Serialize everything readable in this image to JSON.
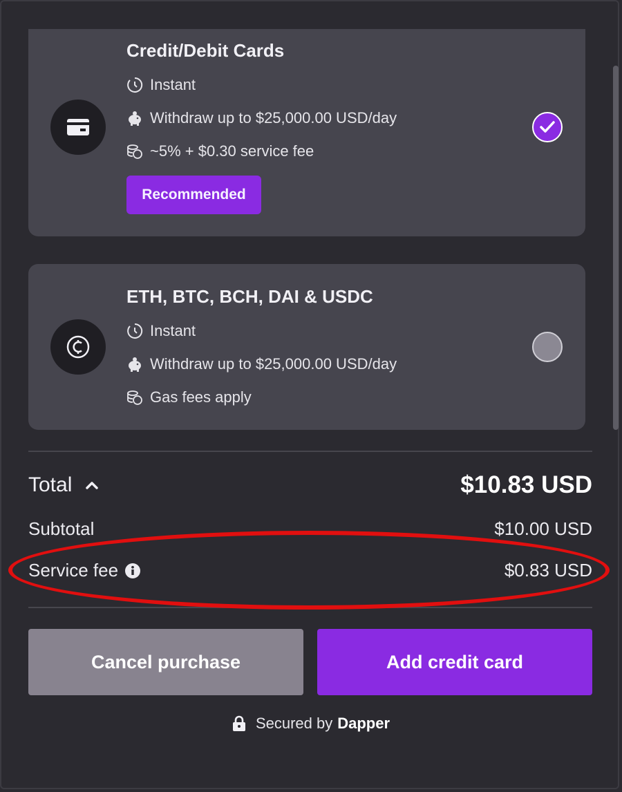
{
  "payment_options": [
    {
      "title": "Credit/Debit Cards",
      "icon": "credit-card-icon",
      "speed": "Instant",
      "limit": "Withdraw up to $25,000.00 USD/day",
      "fee": "~5% + $0.30 service fee",
      "badge": "Recommended",
      "selected": true
    },
    {
      "title": "ETH, BTC, BCH, DAI & USDC",
      "icon": "crypto-coin-icon",
      "speed": "Instant",
      "limit": "Withdraw up to $25,000.00 USD/day",
      "fee": "Gas fees apply",
      "selected": false
    }
  ],
  "summary": {
    "total_label": "Total",
    "total_value": "$10.83 USD",
    "subtotal_label": "Subtotal",
    "subtotal_value": "$10.00 USD",
    "service_fee_label": "Service fee",
    "service_fee_value": "$0.83 USD"
  },
  "actions": {
    "cancel_label": "Cancel purchase",
    "add_label": "Add credit card"
  },
  "footer": {
    "secured_text": "Secured by",
    "brand": "Dapper"
  },
  "colors": {
    "accent": "#8a2be2",
    "background": "#2b2a30",
    "card": "#46454e",
    "annotation": "#e10f0f"
  }
}
